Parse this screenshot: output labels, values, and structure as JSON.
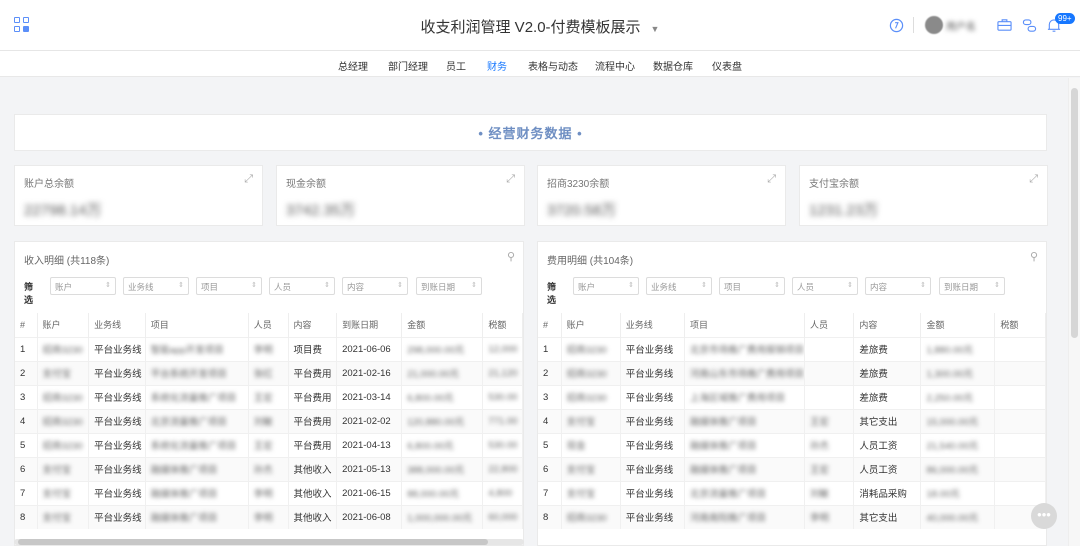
{
  "header": {
    "title": "收支利润管理 V2.0-付费模板展示",
    "caret": "▼",
    "username": "用户名",
    "badge": "99+",
    "icons": [
      "apps-icon",
      "info-icon",
      "avatar",
      "briefcase-icon",
      "link-icon",
      "bell-icon"
    ]
  },
  "nav": {
    "items": [
      "总经理",
      "部门经理",
      "员工",
      "财务",
      "表格与动态",
      "流程中心",
      "数据仓库",
      "仪表盘"
    ],
    "active": "财务"
  },
  "banner": {
    "title": "• 经营财务数据 •"
  },
  "stats": [
    {
      "label": "账户总余额",
      "value": "22798.14万"
    },
    {
      "label": "现金余额",
      "value": "3742.35万"
    },
    {
      "label": "招商3230余额",
      "value": "3720.58万"
    },
    {
      "label": "支付宝余额",
      "value": "1231.23万"
    }
  ],
  "income": {
    "title": "收入明细 (共118条)",
    "filter_label": "筛选",
    "filters": [
      "账户",
      "业务线",
      "项目",
      "人员",
      "内容",
      "到账日期"
    ],
    "columns": [
      "#",
      "账户",
      "业务线",
      "项目",
      "人员",
      "内容",
      "到账日期",
      "金额",
      "税额"
    ],
    "rows": [
      [
        "1",
        "招商3230",
        "平台业务线",
        "智能app开发项目",
        "李明",
        "项目费",
        "2021-06-06",
        "298,000.00元",
        "12,000"
      ],
      [
        "2",
        "支付宝",
        "平台业务线",
        "平台系统开发项目",
        "张红",
        "平台费用",
        "2021-02-16",
        "21,000.00元",
        "21,120"
      ],
      [
        "3",
        "招商3230",
        "平台业务线",
        "系统化流量推广项目",
        "王宏",
        "平台费用",
        "2021-03-14",
        "6,800.00元",
        "530.00"
      ],
      [
        "4",
        "招商3230",
        "平台业务线",
        "北京流量推广项目",
        "刘敏",
        "平台费用",
        "2021-02-02",
        "120,880.00元",
        "771.00"
      ],
      [
        "5",
        "招商3230",
        "平台业务线",
        "系统化流量推广项目",
        "王宏",
        "平台费用",
        "2021-04-13",
        "6,800.00元",
        "530.00"
      ],
      [
        "6",
        "支付宝",
        "平台业务线",
        "融媒体推广项目",
        "孙杰",
        "其他收入",
        "2021-05-13",
        "388,000.00元",
        "22,800"
      ],
      [
        "7",
        "支付宝",
        "平台业务线",
        "融媒体推广项目",
        "李明",
        "其他收入",
        "2021-06-15",
        "88,000.00元",
        "4,800"
      ],
      [
        "8",
        "支付宝",
        "平台业务线",
        "融媒体推广项目",
        "李明",
        "其他收入",
        "2021-06-08",
        "1,000,000.00元",
        "60,000"
      ]
    ]
  },
  "expense": {
    "title": "费用明细 (共104条)",
    "filter_label": "筛选",
    "filters": [
      "账户",
      "业务线",
      "项目",
      "人员",
      "内容",
      "到账日期"
    ],
    "columns": [
      "#",
      "账户",
      "业务线",
      "项目",
      "人员",
      "内容",
      "金额",
      "税额"
    ],
    "rows": [
      [
        "1",
        "招商3230",
        "平台业务线",
        "北京市场推广费用报销项目",
        "",
        "差旅费",
        "1,880.00元",
        ""
      ],
      [
        "2",
        "招商3230",
        "平台业务线",
        "河南山东市场推广费用项目",
        "",
        "差旅费",
        "1,300.00元",
        ""
      ],
      [
        "3",
        "招商3230",
        "平台业务线",
        "上海区域推广费用项目",
        "",
        "差旅费",
        "2,250.00元",
        ""
      ],
      [
        "4",
        "支付宝",
        "平台业务线",
        "融媒体推广项目",
        "王宏",
        "其它支出",
        "15,000.00元",
        ""
      ],
      [
        "5",
        "现金",
        "平台业务线",
        "融媒体推广项目",
        "孙杰",
        "人员工资",
        "21,540.00元",
        ""
      ],
      [
        "6",
        "支付宝",
        "平台业务线",
        "融媒体推广项目",
        "王宏",
        "人员工资",
        "86,000.00元",
        ""
      ],
      [
        "7",
        "支付宝",
        "平台业务线",
        "北京流量推广项目",
        "刘敏",
        "消耗品采购",
        "18.00元",
        ""
      ],
      [
        "8",
        "招商3230",
        "平台业务线",
        "河南南阳推广项目",
        "李明",
        "其它支出",
        "40,000.00元",
        ""
      ]
    ]
  },
  "float_button": {
    "label": "•••"
  }
}
